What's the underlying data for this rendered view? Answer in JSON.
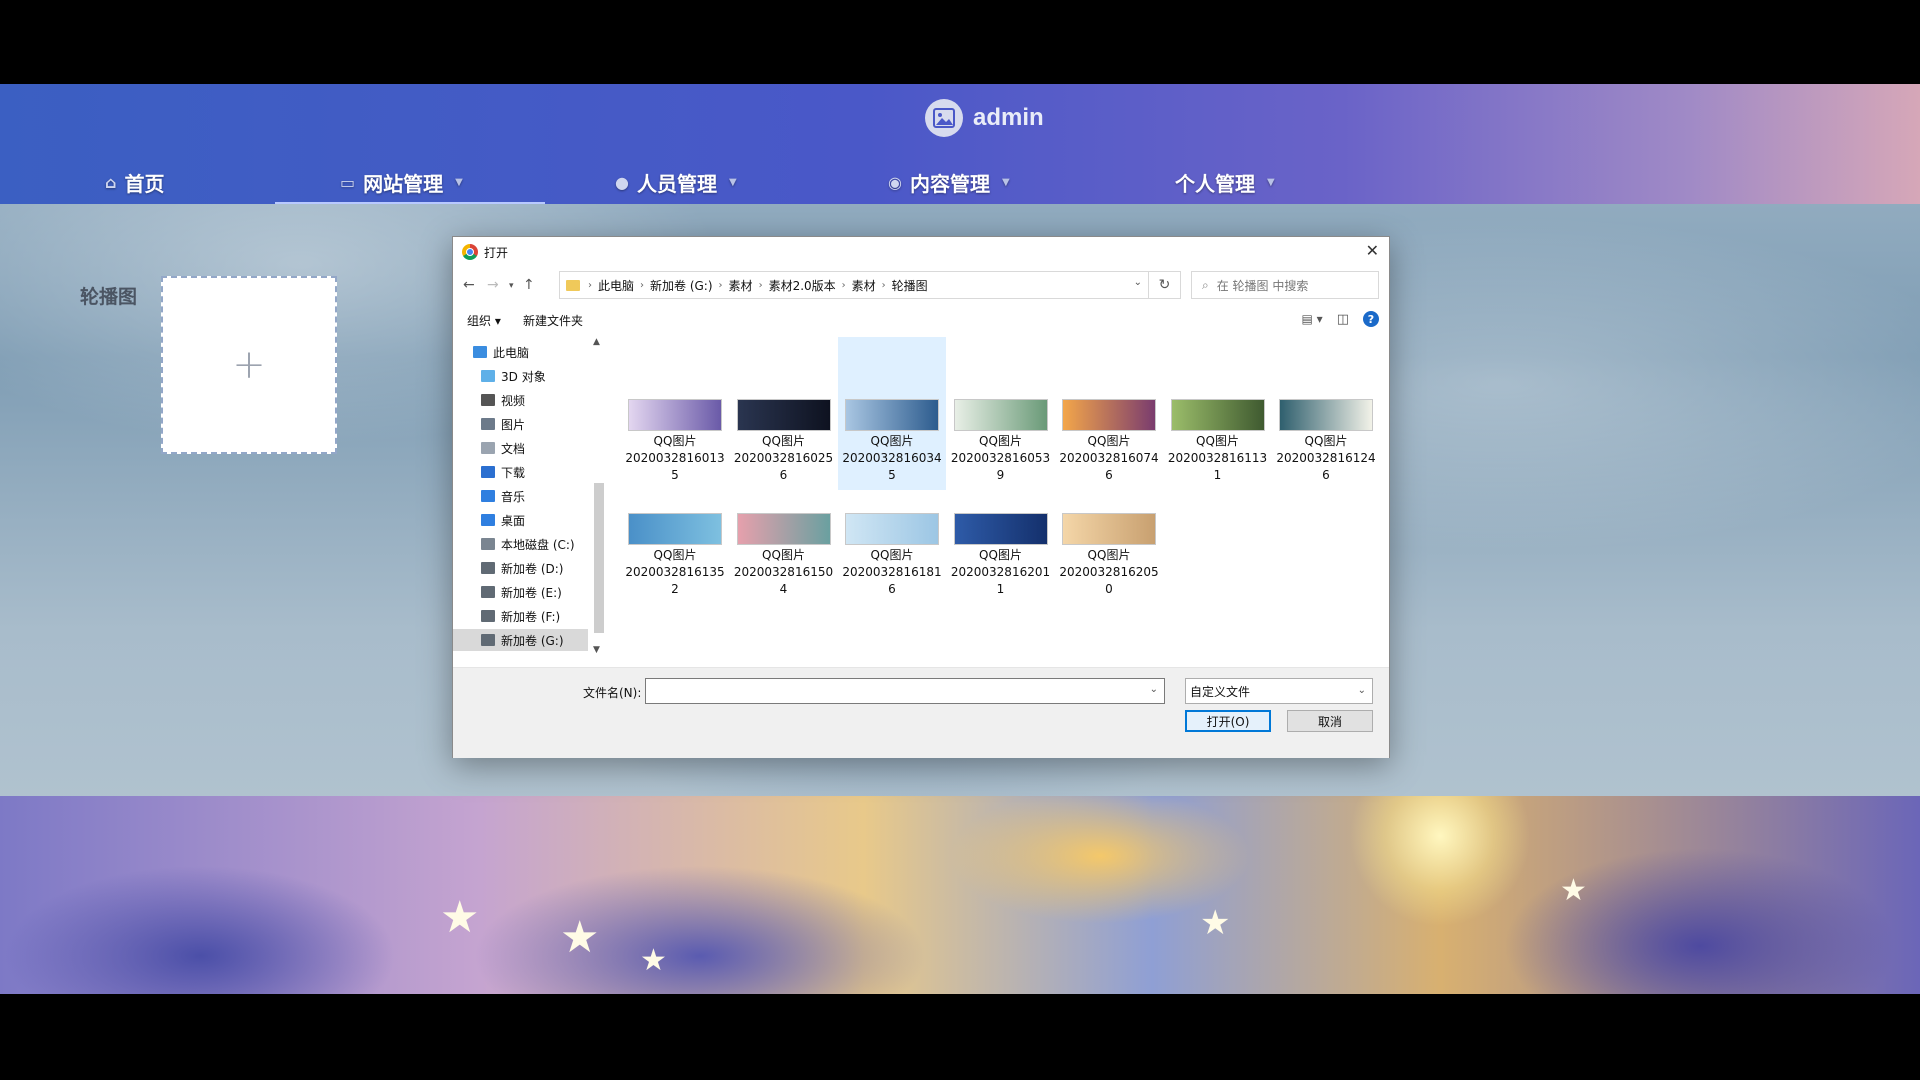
{
  "header": {
    "user": "admin",
    "nav": [
      {
        "label": "首页",
        "icon": "home-icon"
      },
      {
        "label": "网站管理",
        "icon": "monitor-icon"
      },
      {
        "label": "人员管理",
        "icon": "user-icon"
      },
      {
        "label": "内容管理",
        "icon": "chat-icon"
      },
      {
        "label": "个人管理",
        "icon": ""
      }
    ]
  },
  "page": {
    "carousel_label": "轮播图",
    "upload_plus": "+"
  },
  "dialog": {
    "title": "打开",
    "close": "✕",
    "breadcrumb": [
      "此电脑",
      "新加卷 (G:)",
      "素材",
      "素材2.0版本",
      "素材",
      "轮播图"
    ],
    "search_placeholder": "在 轮播图 中搜索",
    "toolbar": {
      "organize": "组织 ▾",
      "new_folder": "新建文件夹",
      "help": "?"
    },
    "tree": [
      {
        "label": "此电脑",
        "color": "#3a8de0"
      },
      {
        "label": "3D 对象",
        "color": "#5fb0e8"
      },
      {
        "label": "视频",
        "color": "#555555"
      },
      {
        "label": "图片",
        "color": "#6c7a8a"
      },
      {
        "label": "文档",
        "color": "#9aa4b0"
      },
      {
        "label": "下载",
        "color": "#2b6fd0"
      },
      {
        "label": "音乐",
        "color": "#2f7fe0"
      },
      {
        "label": "桌面",
        "color": "#2f7fe0"
      },
      {
        "label": "本地磁盘 (C:)",
        "color": "#7a8591"
      },
      {
        "label": "新加卷 (D:)",
        "color": "#606a74"
      },
      {
        "label": "新加卷 (E:)",
        "color": "#606a74"
      },
      {
        "label": "新加卷 (F:)",
        "color": "#606a74"
      },
      {
        "label": "新加卷 (G:)",
        "color": "#606a74"
      }
    ],
    "files": [
      {
        "name": "QQ图片",
        "l2": "2020032816013",
        "l3": "5",
        "c1": "#e3d6f0",
        "c2": "#6a5aa8"
      },
      {
        "name": "QQ图片",
        "l2": "2020032816025",
        "l3": "6",
        "c1": "#2a3550",
        "c2": "#0e1220"
      },
      {
        "name": "QQ图片",
        "l2": "2020032816034",
        "l3": "5",
        "c1": "#a9c6e2",
        "c2": "#2d5c8e"
      },
      {
        "name": "QQ图片",
        "l2": "2020032816053",
        "l3": "9",
        "c1": "#e8efe6",
        "c2": "#6a9a78"
      },
      {
        "name": "QQ图片",
        "l2": "2020032816074",
        "l3": "6",
        "c1": "#f3a64a",
        "c2": "#7a3c6e"
      },
      {
        "name": "QQ图片",
        "l2": "2020032816113",
        "l3": "1",
        "c1": "#9bbd6a",
        "c2": "#3f5a30"
      },
      {
        "name": "QQ图片",
        "l2": "2020032816124",
        "l3": "6",
        "c1": "#2f5f6e",
        "c2": "#f2f2e8"
      },
      {
        "name": "QQ图片",
        "l2": "2020032816135",
        "l3": "2",
        "c1": "#4a90c8",
        "c2": "#7ec0e0"
      },
      {
        "name": "QQ图片",
        "l2": "2020032816150",
        "l3": "4",
        "c1": "#e6a0ac",
        "c2": "#6aa0a0"
      },
      {
        "name": "QQ图片",
        "l2": "2020032816181",
        "l3": "6",
        "c1": "#d0e6f4",
        "c2": "#9cc6e4"
      },
      {
        "name": "QQ图片",
        "l2": "2020032816201",
        "l3": "1",
        "c1": "#2e5ba8",
        "c2": "#14306c"
      },
      {
        "name": "QQ图片",
        "l2": "2020032816205",
        "l3": "0",
        "c1": "#f4d6a8",
        "c2": "#c8a070"
      }
    ],
    "filename_label": "文件名(N):",
    "filename_value": "",
    "filter": "自定义文件",
    "open_button": "打开(O)",
    "cancel_button": "取消"
  }
}
